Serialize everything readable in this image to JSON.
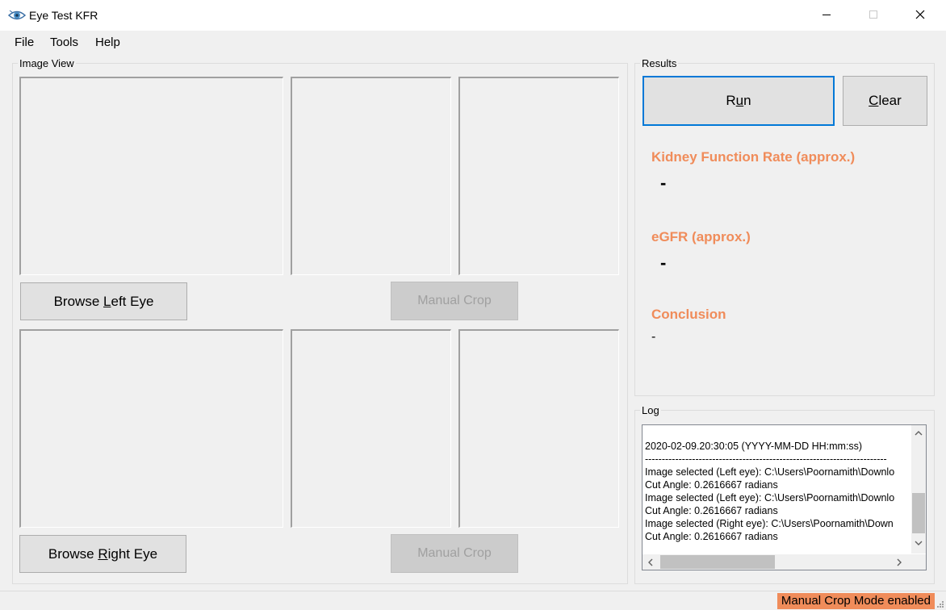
{
  "window": {
    "title": "Eye Test KFR",
    "app_icon": "eye-icon"
  },
  "menu": {
    "file": "File",
    "tools": "Tools",
    "help": "Help"
  },
  "image_view": {
    "label": "Image View",
    "left_eye": {
      "browse_prefix": "Browse ",
      "browse_accel": "L",
      "browse_suffix": "eft Eye",
      "manual_crop": "Manual Crop"
    },
    "right_eye": {
      "browse_prefix": "Browse ",
      "browse_accel": "R",
      "browse_suffix": "ight Eye",
      "manual_crop": "Manual Crop"
    }
  },
  "results": {
    "label": "Results",
    "run_prefix": "R",
    "run_accel": "u",
    "run_suffix": "n",
    "clear_accel": "C",
    "clear_suffix": "lear",
    "kfr_label": "Kidney Function Rate (approx.)",
    "kfr_value": "-",
    "egfr_label": "eGFR (approx.)",
    "egfr_value": "-",
    "conclusion_label": "Conclusion",
    "conclusion_value": "-"
  },
  "log": {
    "label": "Log",
    "lines": [
      "2020-02-09.20:30:05 (YYYY-MM-DD  HH:mm:ss)",
      "------------------------------------------------------------------------",
      "Image selected (Left eye): C:\\Users\\Poornamith\\Downlo",
      "Cut Angle: 0.2616667 radians",
      "Image selected (Left eye): C:\\Users\\Poornamith\\Downlo",
      "Cut Angle: 0.2616667 radians",
      "Image selected (Right eye): C:\\Users\\Poornamith\\Down",
      "Cut Angle: 0.2616667 radians"
    ]
  },
  "status": {
    "text": "Manual Crop Mode enabled"
  },
  "colors": {
    "accent": "#f08c5a",
    "focus": "#0078d7"
  }
}
